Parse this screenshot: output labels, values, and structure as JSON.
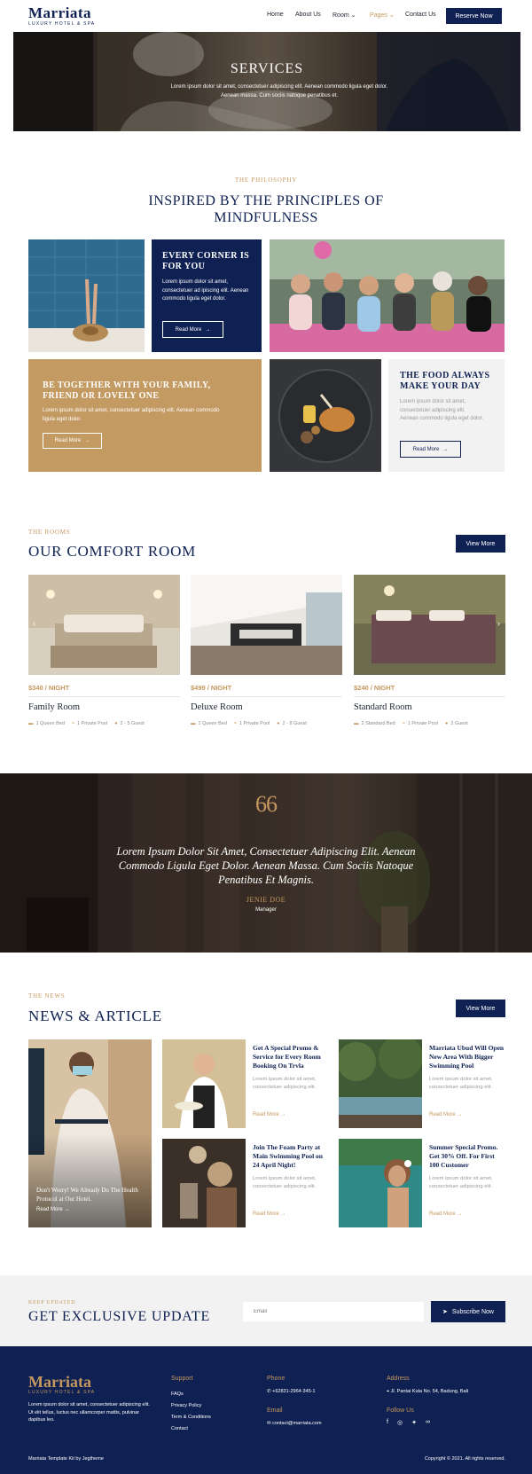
{
  "brand": {
    "name": "Marriata",
    "tagline": "LUXURY HOTEL & SPA"
  },
  "nav": {
    "items": [
      "Home",
      "About Us",
      "Room",
      "Pages",
      "Contact Us"
    ],
    "room_caret": "⌄",
    "pages_caret": "⌄",
    "cta": "Reserve Now",
    "active": "Pages"
  },
  "hero": {
    "title": "SERVICES",
    "subtitle": "Lorem ipsum dolor sit amet, consectetuer adipiscing elit. Aenean commodo ligula eget dolor. Aenean massa. Cum sociis natoque penatibus et."
  },
  "philosophy": {
    "kicker": "THE PHILOSOPHY",
    "title": "INSPIRED BY THE PRINCIPLES OF MINDFULNESS",
    "card1": {
      "title": "EVERY CORNER IS FOR YOU",
      "text": "Lorem ipsum dolor sit amet, consectetuer ad ipiscing elit. Aenean commodo ligula eget dolor.",
      "button": "Read More",
      "arrow": "→"
    },
    "card2": {
      "title": "BE TOGETHER WITH YOUR FAMILY, FRIEND OR LOVELY ONE",
      "text": "Lorem ipsum dolor sit amet, consectetuer adipiscing elit. Aenean commodo ligula eget dolor.",
      "button": "Read More",
      "arrow": "→"
    },
    "card3": {
      "title": "THE FOOD ALWAYS MAKE YOUR DAY",
      "text": "Lorem ipsum dolor sit amet, consectetuer adipiscing elit. Aenean commodo ligula eget dolor.",
      "button": "Read More",
      "arrow": "→"
    }
  },
  "rooms": {
    "kicker": "THE ROOMS",
    "title": "OUR COMFORT ROOM",
    "view_more": "View More",
    "prev": "‹",
    "next": "›",
    "items": [
      {
        "price": "$340 / NIGHT",
        "name": "Family Room",
        "features": [
          "1 Queen Bed",
          "1 Private Pool",
          "2 - 5 Guest"
        ]
      },
      {
        "price": "$499 / NIGHT",
        "name": "Deluxe Room",
        "features": [
          "1 Queen Bed",
          "1 Private Pool",
          "2 - 8 Guest"
        ]
      },
      {
        "price": "$240 / NIGHT",
        "name": "Standard Room",
        "features": [
          "2 Standard Bed",
          "1 Private Pool",
          "2 Guest"
        ]
      }
    ]
  },
  "testimonial": {
    "quote_mark": "66",
    "quote": "Lorem Ipsum Dolor Sit Amet, Consectetuer Adipiscing Elit. Aenean Commodo Ligula Eget Dolor. Aenean Massa. Cum Sociis Natoque Penatibus Et Magnis.",
    "name": "JENIE DOE",
    "role": "Manager"
  },
  "news": {
    "kicker": "THE NEWS",
    "title": "NEWS & ARTICLE",
    "view_more": "View More",
    "featured": {
      "title": "Don't Worry! We Already Do The Health Protocol at Our Hotel.",
      "more": "Read More",
      "arrow": "→"
    },
    "items": [
      {
        "title": "Get A Special Promo & Service for Every Room Booking On Trvla",
        "text": "Lorem ipsum dolor sit amet, consectetuer adipiscing elit.",
        "more": "Read More",
        "arrow": "→"
      },
      {
        "title": "Marriata Ubud Will Open New Area With Bigger Swimming Pool",
        "text": "Lorem ipsum dolor sit amet, consectetuer adipiscing elit.",
        "more": "Read More",
        "arrow": "→"
      },
      {
        "title": "Join The Foam Party at Main Swimming Pool on 24 April Night!",
        "text": "Lorem ipsum dolor sit amet, consectetuer adipiscing elit.",
        "more": "Read More",
        "arrow": "→"
      },
      {
        "title": "Summer Special Promo. Get 30% Off. For First 100 Customer",
        "text": "Lorem ipsum dolor sit amet, consectetuer adipiscing elit.",
        "more": "Read More",
        "arrow": "→"
      }
    ]
  },
  "subscribe": {
    "kicker": "KEEP UPDATED",
    "title": "GET EXCLUSIVE UPDATE",
    "placeholder": "Email",
    "button": "Subscribe Now"
  },
  "footer": {
    "about": "Lorem ipsum dolor sit amet, consectetuer adipiscing elit. Ut elit tellus, luctus nec ullamcorper mattis, pulvinar dapibus leo.",
    "support_title": "Support",
    "support_links": [
      "FAQs",
      "Privacy Policy",
      "Term & Conditions",
      "Contact"
    ],
    "phone_title": "Phone",
    "phone": "+62831-2964-345-1",
    "email_title": "Email",
    "email": "contact@marriata.com",
    "address_title": "Address",
    "address": "Jl. Pantai Kuta No. 54, Badung, Bali",
    "follow_title": "Follow Us",
    "credit": "Marriata Template Kit by Jegtheme",
    "copyright": "Copyright © 2021. All rights reserved."
  },
  "colors": {
    "navy": "#0f2152",
    "gold": "#c5975e",
    "tan": "#c49a63",
    "light": "#f2f2f2"
  }
}
